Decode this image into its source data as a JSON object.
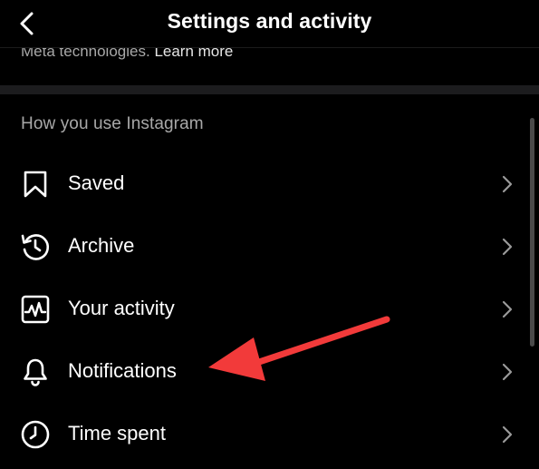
{
  "header": {
    "title": "Settings and activity",
    "back_icon": "chevron-left-icon"
  },
  "meta_notice": {
    "text": "Meta technologies.",
    "link": "Learn more"
  },
  "section": {
    "title": "How you use Instagram",
    "items": [
      {
        "label": "Saved",
        "icon": "bookmark-icon"
      },
      {
        "label": "Archive",
        "icon": "archive-history-icon"
      },
      {
        "label": "Your activity",
        "icon": "activity-icon"
      },
      {
        "label": "Notifications",
        "icon": "bell-icon"
      },
      {
        "label": "Time spent",
        "icon": "clock-icon"
      }
    ]
  },
  "colors": {
    "background": "#000000",
    "text_primary": "#ffffff",
    "text_secondary": "#a8a8a8",
    "separator": "#1c1c1e",
    "annotation_arrow": "#f23a3a"
  }
}
